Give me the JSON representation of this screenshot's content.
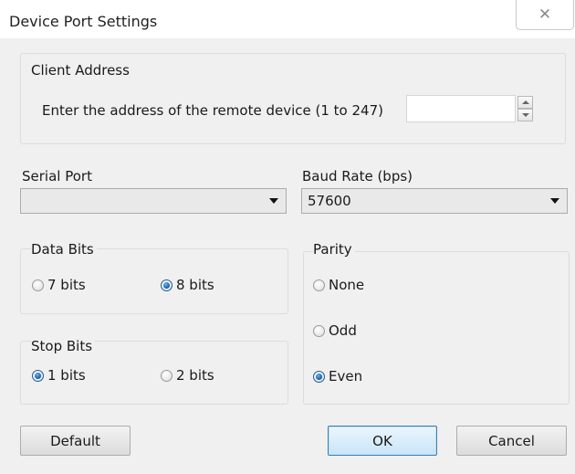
{
  "window": {
    "title": "Device Port Settings"
  },
  "client_address": {
    "group_label": "Client Address",
    "prompt": "Enter the address of the remote device (1 to 247)",
    "value": ""
  },
  "serial_port": {
    "label": "Serial Port",
    "value": ""
  },
  "baud_rate": {
    "label": "Baud Rate (bps)",
    "value": "57600"
  },
  "data_bits": {
    "group_label": "Data Bits",
    "options": [
      {
        "label": "7 bits",
        "checked": false
      },
      {
        "label": "8 bits",
        "checked": true
      }
    ]
  },
  "stop_bits": {
    "group_label": "Stop Bits",
    "options": [
      {
        "label": "1 bits",
        "checked": true
      },
      {
        "label": "2 bits",
        "checked": false
      }
    ]
  },
  "parity": {
    "group_label": "Parity",
    "options": [
      {
        "label": "None",
        "checked": false
      },
      {
        "label": "Odd",
        "checked": false
      },
      {
        "label": "Even",
        "checked": true
      }
    ]
  },
  "buttons": {
    "default": "Default",
    "ok": "OK",
    "cancel": "Cancel"
  },
  "colors": {
    "background": "#f0f0f0",
    "accent": "#1565b8",
    "primary_border": "#3c7fb1"
  },
  "icons": {
    "close": "close-icon"
  }
}
